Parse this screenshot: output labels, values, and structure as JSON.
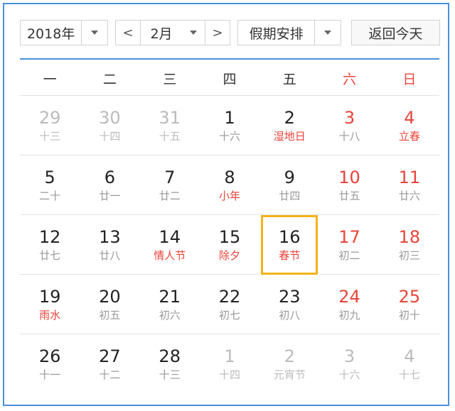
{
  "toolbar": {
    "year_label": "2018年",
    "prev_label": "<",
    "month_label": "2月",
    "next_label": ">",
    "holiday_label": "假期安排",
    "today_label": "返回今天"
  },
  "colors": {
    "accent": "#4a90d9",
    "weekend": "#e8443a",
    "today_border": "#f5b21a",
    "muted": "#bbbbbb"
  },
  "weekdays": [
    {
      "label": "一",
      "weekend": false
    },
    {
      "label": "二",
      "weekend": false
    },
    {
      "label": "三",
      "weekend": false
    },
    {
      "label": "四",
      "weekend": false
    },
    {
      "label": "五",
      "weekend": false
    },
    {
      "label": "六",
      "weekend": true
    },
    {
      "label": "日",
      "weekend": true
    }
  ],
  "days": [
    {
      "day": "29",
      "sub": "十三",
      "other": true
    },
    {
      "day": "30",
      "sub": "十四",
      "other": true
    },
    {
      "day": "31",
      "sub": "十五",
      "other": true
    },
    {
      "day": "1",
      "sub": "十六"
    },
    {
      "day": "2",
      "sub": "湿地日",
      "festival": true
    },
    {
      "day": "3",
      "sub": "十八",
      "weekend": true
    },
    {
      "day": "4",
      "sub": "立春",
      "weekend": true,
      "festival": true
    },
    {
      "day": "5",
      "sub": "二十"
    },
    {
      "day": "6",
      "sub": "廿一"
    },
    {
      "day": "7",
      "sub": "廿二"
    },
    {
      "day": "8",
      "sub": "小年",
      "festival": true
    },
    {
      "day": "9",
      "sub": "廿四"
    },
    {
      "day": "10",
      "sub": "廿五",
      "weekend": true
    },
    {
      "day": "11",
      "sub": "廿六",
      "weekend": true
    },
    {
      "day": "12",
      "sub": "廿七"
    },
    {
      "day": "13",
      "sub": "廿八"
    },
    {
      "day": "14",
      "sub": "情人节",
      "festival": true
    },
    {
      "day": "15",
      "sub": "除夕",
      "festival": true
    },
    {
      "day": "16",
      "sub": "春节",
      "festival": true,
      "today": true
    },
    {
      "day": "17",
      "sub": "初二",
      "weekend": true
    },
    {
      "day": "18",
      "sub": "初三",
      "weekend": true
    },
    {
      "day": "19",
      "sub": "雨水",
      "festival": true
    },
    {
      "day": "20",
      "sub": "初五"
    },
    {
      "day": "21",
      "sub": "初六"
    },
    {
      "day": "22",
      "sub": "初七"
    },
    {
      "day": "23",
      "sub": "初八"
    },
    {
      "day": "24",
      "sub": "初九",
      "weekend": true
    },
    {
      "day": "25",
      "sub": "初十",
      "weekend": true
    },
    {
      "day": "26",
      "sub": "十一"
    },
    {
      "day": "27",
      "sub": "十二"
    },
    {
      "day": "28",
      "sub": "十三"
    },
    {
      "day": "1",
      "sub": "十四",
      "other": true
    },
    {
      "day": "2",
      "sub": "元宵节",
      "other": true
    },
    {
      "day": "3",
      "sub": "十六",
      "other": true
    },
    {
      "day": "4",
      "sub": "十七",
      "other": true
    }
  ]
}
